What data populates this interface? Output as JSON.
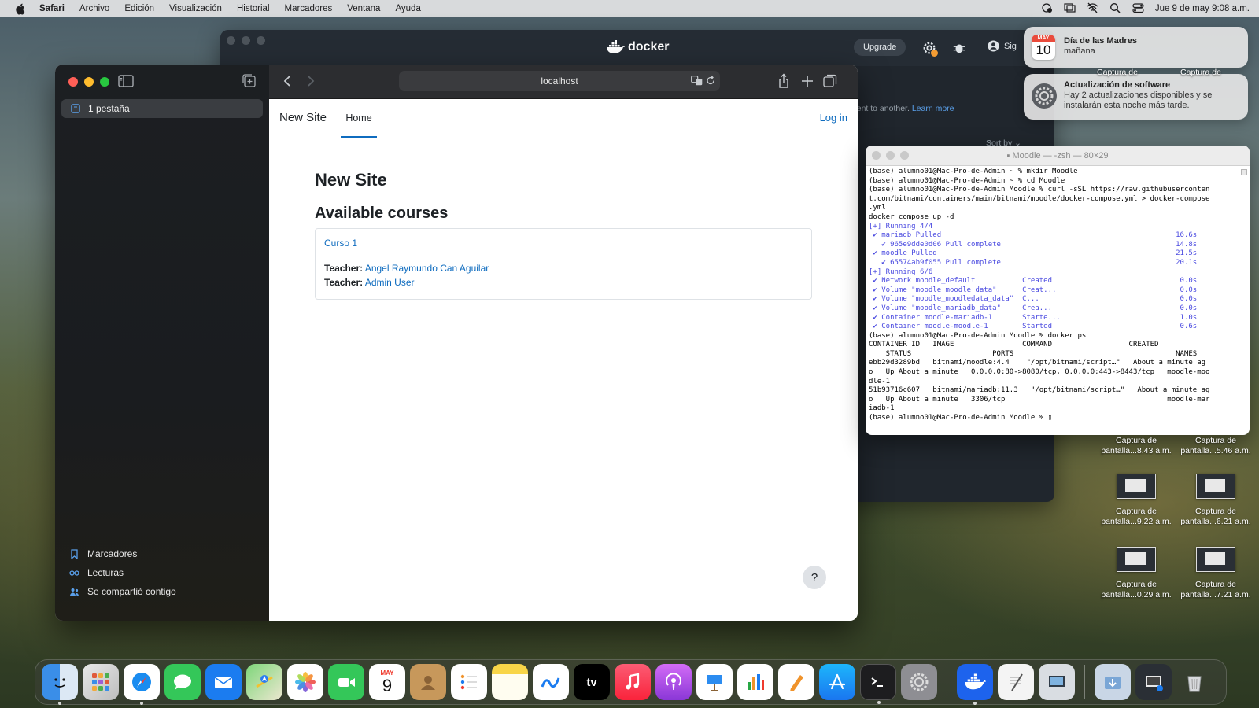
{
  "menubar": {
    "app": "Safari",
    "items": [
      "Archivo",
      "Edición",
      "Visualización",
      "Historial",
      "Marcadores",
      "Ventana",
      "Ayuda"
    ],
    "clock": "Jue 9 de may  9:08 a.m."
  },
  "docker": {
    "logo": "docker",
    "upgrade": "Upgrade",
    "sign": "Sig",
    "subtitle": "ment to another.",
    "learn_more": "Learn more",
    "sort": "Sort by ⌄"
  },
  "safari": {
    "tab_group": "1 pestaña",
    "url": "localhost",
    "sidebar_bottom": [
      "Marcadores",
      "Lecturas",
      "Se compartió contigo"
    ]
  },
  "page": {
    "site_name": "New Site",
    "nav_home": "Home",
    "login": "Log in",
    "title": "New Site",
    "courses_heading": "Available courses",
    "course": {
      "name": "Curso 1",
      "teacher_label": "Teacher:",
      "teachers": [
        "Angel Raymundo Can Aguilar",
        "Admin User"
      ]
    },
    "help": "?"
  },
  "terminal": {
    "title": "Moodle — -zsh — 80×29",
    "lines": [
      {
        "text": "(base) alumno01@Mac-Pro-de-Admin ~ % mkdir Moodle",
        "style": "n"
      },
      {
        "text": "(base) alumno01@Mac-Pro-de-Admin ~ % cd Moodle",
        "style": "n"
      },
      {
        "text": "(base) alumno01@Mac-Pro-de-Admin Moodle % curl -sSL https://raw.githubuserconten",
        "style": "n"
      },
      {
        "text": "t.com/bitnami/containers/main/bitnami/moodle/docker-compose.yml > docker-compose",
        "style": "n"
      },
      {
        "text": ".yml",
        "style": "n"
      },
      {
        "text": "docker compose up -d",
        "style": "n"
      },
      {
        "text": "[+] Running 4/4",
        "style": "b"
      },
      {
        "text": " ✔ mariadb Pulled                                                       16.6s",
        "style": "b"
      },
      {
        "text": "   ✔ 965e9dde0d06 Pull complete                                         14.8s",
        "style": "b"
      },
      {
        "text": " ✔ moodle Pulled                                                        21.5s",
        "style": "b"
      },
      {
        "text": "   ✔ 65574ab9f055 Pull complete                                         20.1s",
        "style": "b"
      },
      {
        "text": "[+] Running 6/6",
        "style": "b"
      },
      {
        "text": " ✔ Network moodle_default           Created                              0.0s",
        "style": "b"
      },
      {
        "text": " ✔ Volume \"moodle_moodle_data\"      Creat...                             0.0s",
        "style": "b"
      },
      {
        "text": " ✔ Volume \"moodle_moodledata_data\"  C...                                 0.0s",
        "style": "b"
      },
      {
        "text": " ✔ Volume \"moodle_mariadb_data\"     Crea...                              0.0s",
        "style": "b"
      },
      {
        "text": " ✔ Container moodle-mariadb-1       Starte...                            1.0s",
        "style": "b"
      },
      {
        "text": " ✔ Container moodle-moodle-1        Started                              0.6s",
        "style": "b"
      },
      {
        "text": "(base) alumno01@Mac-Pro-de-Admin Moodle % docker ps",
        "style": "n"
      },
      {
        "text": "CONTAINER ID   IMAGE                COMMAND                  CREATED",
        "style": "n"
      },
      {
        "text": "    STATUS                   PORTS                                      NAMES",
        "style": "n"
      },
      {
        "text": "ebb29d3289bd   bitnami/moodle:4.4    \"/opt/bitnami/script…\"   About a minute ag",
        "style": "n"
      },
      {
        "text": "o   Up About a minute   0.0.0.0:80->8080/tcp, 0.0.0.0:443->8443/tcp   moodle-moo",
        "style": "n"
      },
      {
        "text": "dle-1",
        "style": "n"
      },
      {
        "text": "51b93716c607   bitnami/mariadb:11.3   \"/opt/bitnami/script…\"   About a minute ag",
        "style": "n"
      },
      {
        "text": "o   Up About a minute   3306/tcp                                      moodle-mar",
        "style": "n"
      },
      {
        "text": "iadb-1",
        "style": "n"
      },
      {
        "text": "(base) alumno01@Mac-Pro-de-Admin Moodle % ▯",
        "style": "n"
      }
    ]
  },
  "notifications": [
    {
      "title": "Día de las Madres",
      "body": "mañana",
      "cal_month": "MAY",
      "cal_day": "10"
    },
    {
      "title": "Actualización de software",
      "body": "Hay 2 actualizaciones disponibles y se instalarán esta noche más tarde."
    }
  ],
  "desktop": {
    "partial_top": [
      "Captura de",
      "Captura de"
    ],
    "files": [
      {
        "l1": "Captura de",
        "l2": "pantalla...8.43 a.m."
      },
      {
        "l1": "Captura de",
        "l2": "pantalla...5.46 a.m."
      },
      {
        "l1": "Captura de",
        "l2": "pantalla...9.22 a.m."
      },
      {
        "l1": "Captura de",
        "l2": "pantalla...6.21 a.m."
      },
      {
        "l1": "Captura de",
        "l2": "pantalla...0.29 a.m."
      },
      {
        "l1": "Captura de",
        "l2": "pantalla...7.21 a.m."
      }
    ]
  },
  "dock": {
    "calendar_month": "MAY",
    "calendar_day": "9",
    "appletv_label": "tv",
    "apps": [
      "finder-icon",
      "launchpad-icon",
      "safari-icon",
      "messages-icon",
      "mail-icon",
      "maps-icon",
      "photos-icon",
      "facetime-icon",
      "calendar-icon",
      "contacts-icon",
      "reminders-icon",
      "notes-icon",
      "freeform-icon",
      "appletv-icon",
      "music-icon",
      "podcasts-icon",
      "keynote-icon",
      "numbers-icon",
      "pages-icon",
      "appstore-icon",
      "terminal-icon",
      "system-settings-icon",
      "docker-icon",
      "textedit-icon",
      "preview-icon",
      "downloads-folder-icon",
      "screenshots-stack-icon",
      "trash-icon"
    ]
  }
}
